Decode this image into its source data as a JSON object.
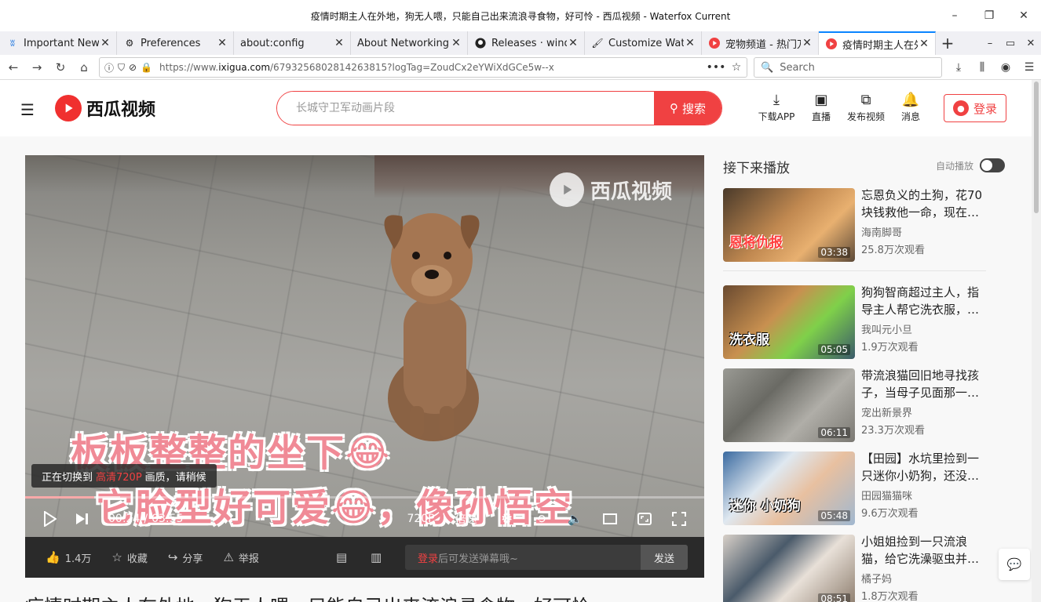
{
  "window": {
    "title": "疫情时期主人在外地，狗无人喂，只能自己出来流浪寻食物，好可怜 - 西瓜视频 - Waterfox Current",
    "controls": [
      "–",
      "❐",
      "✕"
    ]
  },
  "tabs": [
    {
      "label": "Important News",
      "icon": "news-icon"
    },
    {
      "label": "Preferences",
      "icon": "gear-icon"
    },
    {
      "label": "about:config",
      "icon": ""
    },
    {
      "label": "About Networking",
      "icon": ""
    },
    {
      "label": "Releases · wind",
      "icon": "github-icon"
    },
    {
      "label": "Customize Wate",
      "icon": "brush-icon"
    },
    {
      "label": "宠物频道 - 热门万",
      "icon": "xigua-icon"
    },
    {
      "label": "疫情时期主人在外",
      "icon": "xigua-icon",
      "active": true
    }
  ],
  "nav": {
    "url_prefix": "https://www.",
    "url_host": "ixigua.com",
    "url_path": "/6793256802814263815?logTag=ZoudCx2eYWiXdGCe5w--x",
    "search_placeholder": "Search"
  },
  "site": {
    "logo_text": "西瓜视频",
    "search_placeholder": "长城守卫军动画片段",
    "search_button": "搜索",
    "actions": [
      {
        "label": "下载APP",
        "icon": "download-icon"
      },
      {
        "label": "直播",
        "icon": "live-tv-icon"
      },
      {
        "label": "发布视频",
        "icon": "upload-video-icon"
      },
      {
        "label": "消息",
        "icon": "bell-icon"
      }
    ],
    "login": "登录"
  },
  "video": {
    "watermark": "西瓜视频",
    "subtitle1": "板板整整的坐下😂",
    "subtitle2": "它脸型好可爱😂，像孙悟空",
    "toast_prefix": "正在切换到",
    "toast_quality": "高清720P",
    "toast_suffix": "画质，请稍候",
    "current_time": "00:24",
    "separator": "/",
    "duration": "03:55",
    "progress_fraction": 0.102,
    "buffered_fraction": 0.14,
    "quality": "720P",
    "speed": "倍速"
  },
  "actions": {
    "like_count": "1.4万",
    "favorite": "收藏",
    "share": "分享",
    "report": "举报",
    "danmu_login": "登录",
    "danmu_hint": "后可发送弹幕哦~",
    "send": "发送"
  },
  "page_title": "疫情时期主人在外地，狗无人喂，只能自己出来流浪寻食物，好可怜",
  "sidebar": {
    "header": "接下来播放",
    "autoplay": "自动播放",
    "items": [
      {
        "title": "忘恩负义的土狗，花70块钱救他一命，现在…",
        "author": "海南脚哥",
        "views": "25.8万次观看",
        "duration": "03:38",
        "caption": "恩将仇报"
      },
      {
        "title": "狗狗智商超过主人，指导主人帮它洗衣服，…",
        "author": "我叫元小旦",
        "views": "1.9万次观看",
        "duration": "05:05",
        "caption": "洗衣服"
      },
      {
        "title": "带流浪猫回旧地寻找孩子，当母子见面那一…",
        "author": "宠出新景界",
        "views": "23.3万次观看",
        "duration": "06:11",
        "caption": ""
      },
      {
        "title": "【田园】水坑里捡到一只迷你小奶狗，还没…",
        "author": "田园猫猫咪",
        "views": "9.6万次观看",
        "duration": "05:48",
        "caption": "迷你 小奶狗"
      },
      {
        "title": "小姐姐捡到一只流浪猫，给它洗澡驱虫并…",
        "author": "橘子妈",
        "views": "1.8万次观看",
        "duration": "08:51",
        "caption": ""
      }
    ]
  }
}
